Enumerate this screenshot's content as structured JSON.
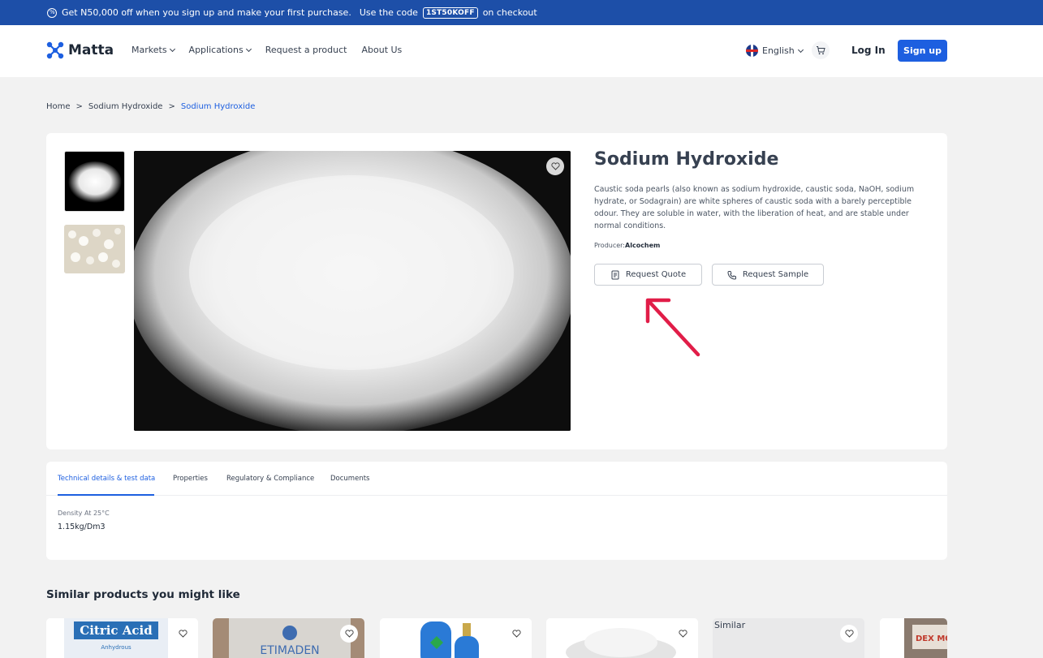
{
  "promo": {
    "text": "Get N50,000 off when you sign up and make your first purchase.",
    "code_prefix": "Use the code",
    "code": "1ST50KOFF",
    "code_suffix": "on checkout"
  },
  "header": {
    "logo": "Matta",
    "nav": [
      {
        "label": "Markets"
      },
      {
        "label": "Applications"
      },
      {
        "label": "Request a product"
      },
      {
        "label": "About Us"
      }
    ],
    "language": "English",
    "login": "Log In",
    "signup": "Sign up"
  },
  "breadcrumb": [
    "Home",
    ">",
    "Sodium Hydroxide",
    ">",
    "Sodium Hydroxide"
  ],
  "product": {
    "title": "Sodium Hydroxide",
    "description": "Caustic soda pearls (also known as sodium hydroxide, caustic soda, NaOH, sodium hydrate, or Sodagrain) are white spheres of caustic soda with a barely perceptible odour. They are soluble in water, with the liberation of heat, and are stable under normal conditions.",
    "producer_label": "Producer:",
    "producer": "Alcochem",
    "request_quote": "Request Quote",
    "request_sample": "Request Sample"
  },
  "tabs": [
    {
      "label": "Technical details & test data",
      "active": true
    },
    {
      "label": "Properties"
    },
    {
      "label": "Regulatory & Compliance"
    },
    {
      "label": "Documents"
    }
  ],
  "spec": {
    "label": "Density At 25°C",
    "value": "1.15kg/Dm3"
  },
  "similar": {
    "title": "Similar products you might like",
    "items": [
      {
        "label": "Citric Acid",
        "sub": "Anhydrous"
      },
      {
        "label": "ETIMADEN"
      },
      {
        "label": ""
      },
      {
        "label": ""
      },
      {
        "label": "Similar"
      },
      {
        "label": "DEX MONO"
      }
    ]
  },
  "colors": {
    "accent": "#1d5fe0",
    "promo_bg": "#1d4fa8",
    "annotation": "#e11d48"
  }
}
